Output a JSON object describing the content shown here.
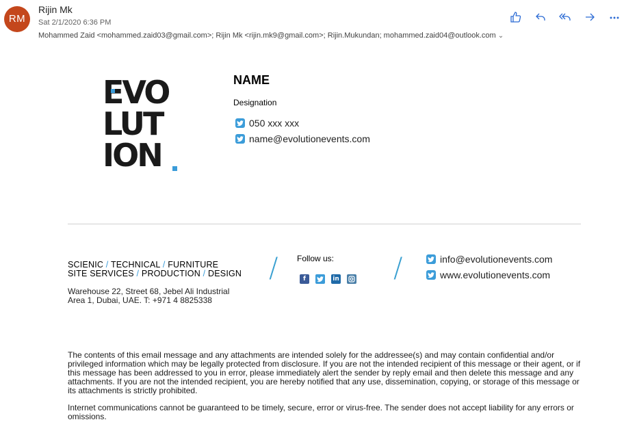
{
  "header": {
    "avatar_initials": "RM",
    "sender": "Rijin Mk",
    "date": "Sat 2/1/2020 6:36 PM",
    "recipients": "Mohammed Zaid <mohammed.zaid03@gmail.com>; Rijin Mk <rijin.mk9@gmail.com>; Rijin.Mukundan; mohammed.zaid04@outlook.com",
    "actions": [
      "like-icon",
      "reply-icon",
      "reply-all-icon",
      "forward-icon",
      "more-icon"
    ]
  },
  "signature": {
    "logo_lines": [
      "EVO",
      "LUT",
      "ION"
    ],
    "name": "NAME",
    "designation": "Designation",
    "phone": "050 xxx xxx",
    "email": "name@evolutionevents.com",
    "services": {
      "line1": [
        "SCIENIC",
        "TECHNICAL",
        "FURNITURE"
      ],
      "line2": [
        "SITE SERVICES",
        "PRODUCTION",
        "DESIGN"
      ]
    },
    "address_line1": "Warehouse 22, Street 68, Jebel Ali Industrial",
    "address_line2": "Area 1, Dubai, UAE. T: +971 4 8825338",
    "follow_label": "Follow us:",
    "divider": "/",
    "company_email": "info@evolutionevents.com",
    "website": "www.evolutionevents.com"
  },
  "disclaimer": {
    "para1": "The contents of this email message and any attachments are intended solely for the addressee(s) and may contain confidential and/or privileged information which may be legally protected from disclosure. If you are not the intended recipient of this message or their agent, or if this message has been addressed to you in error, please immediately alert the sender by reply email and then delete this message and any attachments. If you are not the intended recipient, you are hereby notified that any use, dissemination, copying, or storage of this message or its attachments is strictly prohibited.",
    "para2": "Internet communications cannot be guaranteed to be timely, secure, error or virus-free. The sender does not accept liability for any errors or omissions."
  },
  "colors": {
    "avatar": "#c4471c",
    "accent": "#3b9cd9",
    "action_icons": "#2a6ad4"
  }
}
